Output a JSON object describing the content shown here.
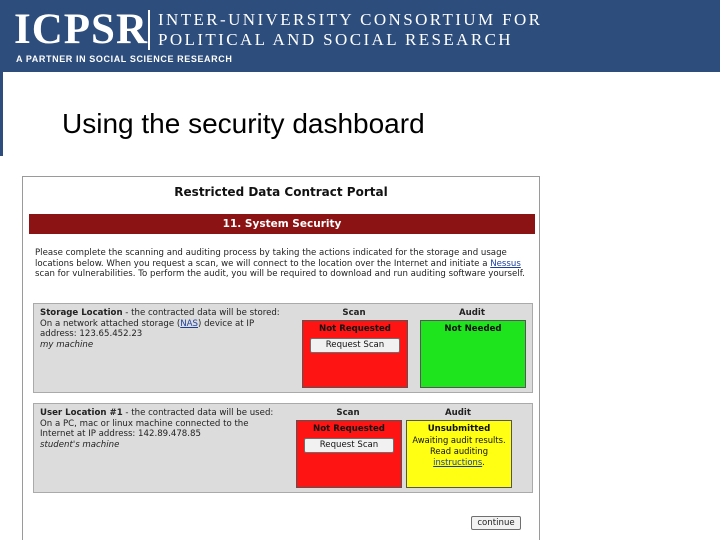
{
  "banner": {
    "logo": "ICPSR",
    "org_line1": "INTER-UNIVERSITY CONSORTIUM FOR",
    "org_line2": "POLITICAL AND SOCIAL RESEARCH",
    "tagline": "A PARTNER IN SOCIAL SCIENCE RESEARCH",
    "color": "#2d4d7c"
  },
  "slide": {
    "title": "Using the security dashboard"
  },
  "portal": {
    "title": "Restricted Data Contract Portal",
    "section": "11. System Security",
    "section_color": "#8b1313",
    "instructions": {
      "part1": "Please complete the scanning and auditing process by taking the actions indicated for the storage and usage locations below. When you request a scan, we will connect to the location over the Internet and initiate a ",
      "nessus": "Nessus",
      "part2": " scan for vulnerabilities. To perform the audit, you will be required to download and run auditing software yourself."
    },
    "locations": [
      {
        "heading": "Storage Location",
        "heading_rest": " - the contracted data will be stored:",
        "line2_prefix": "On a network attached storage (",
        "line2_link": "NAS",
        "line2_suffix": ") device at IP",
        "line3": "address: 123.65.452.23",
        "name": "my machine",
        "scan_header": "Scan",
        "audit_header": "Audit",
        "scan_status": "Not Requested",
        "scan_button": "Request Scan",
        "audit_status": "Not Needed"
      },
      {
        "heading": "User Location #1",
        "heading_rest": " - the contracted data will be used:",
        "line2": "On a PC, mac or linux machine connected to the",
        "line3": "Internet at IP address: 142.89.478.85",
        "name": "student's machine",
        "scan_header": "Scan",
        "audit_header": "Audit",
        "scan_status": "Not Requested",
        "scan_button": "Request Scan",
        "audit_status": "Unsubmitted",
        "audit_sub1": "Awaiting audit results.",
        "audit_sub2": "Read auditing",
        "audit_link": "instructions",
        "audit_sub_end": "."
      }
    ],
    "continue_label": "continue",
    "status_colors": {
      "red": "#ff1414",
      "green": "#1ee41e",
      "yellow": "#ffff14"
    }
  }
}
